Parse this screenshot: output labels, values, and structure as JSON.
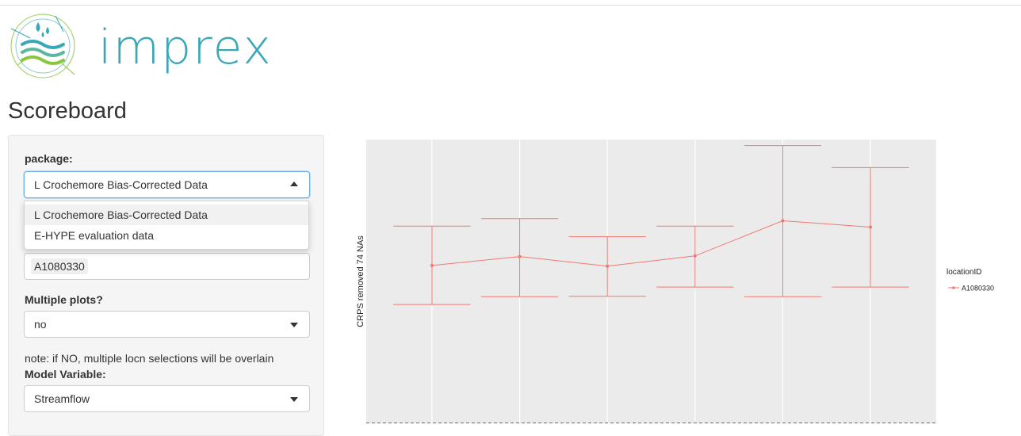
{
  "app": {
    "logo_text": "imprex",
    "page_title": "Scoreboard"
  },
  "sidebar": {
    "package": {
      "label": "package:",
      "selected": "L Crochemore Bias-Corrected Data",
      "options": [
        "L Crochemore Bias-Corrected Data",
        "E-HYPE evaluation data"
      ]
    },
    "location": {
      "selected_tag": "A1080330"
    },
    "multiple_plots": {
      "label": "Multiple plots?",
      "selected": "no"
    },
    "note": "note: if NO, multiple locn selections will be overlain",
    "model_variable": {
      "label": "Model Variable:",
      "selected": "Streamflow"
    }
  },
  "colors": {
    "panel_bg": "#f5f5f5",
    "plot_bg": "#ebebeb",
    "grid": "#ffffff",
    "series": "#f07a72",
    "reference_line": "#1a1a5e",
    "logo_teal": "#3aa7b7",
    "logo_green": "#8cc63f"
  },
  "chart_data": {
    "type": "line",
    "ylabel": "CRPS  removed  74  NAs",
    "x": [
      1,
      2,
      3,
      4,
      5,
      6
    ],
    "series": [
      {
        "name": "A1080330",
        "values": [
          0.445,
          0.47,
          0.443,
          0.472,
          0.571,
          0.553
        ],
        "lower": [
          0.335,
          0.357,
          0.358,
          0.384,
          0.357,
          0.384
        ],
        "upper": [
          0.556,
          0.577,
          0.526,
          0.556,
          0.783,
          0.721
        ]
      }
    ],
    "ylim": [
      0.0,
      0.8
    ],
    "reference_line": 0.0,
    "grid": true,
    "legend": {
      "title": "locationID",
      "entries": [
        "A1080330"
      ],
      "position": "right"
    }
  }
}
